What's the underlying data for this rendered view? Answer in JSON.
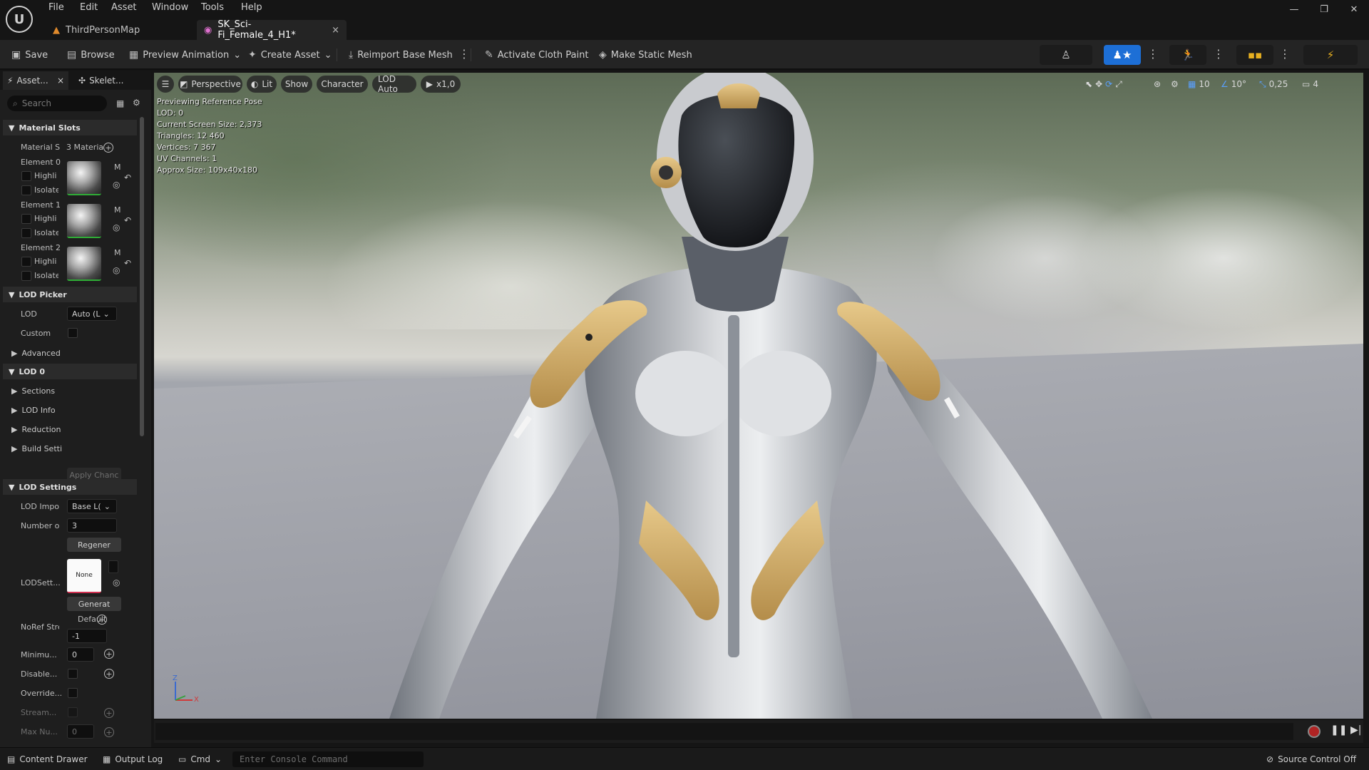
{
  "menu": [
    "File",
    "Edit",
    "Asset",
    "Window",
    "Tools",
    "Help"
  ],
  "tabs": [
    {
      "label": "ThirdPersonMap",
      "active": false
    },
    {
      "label": "SK_Sci-Fi_Female_4_H1*",
      "active": true
    }
  ],
  "toolbar": {
    "save": "Save",
    "browse": "Browse",
    "preview_animation": "Preview Animation",
    "create_asset": "Create Asset",
    "reimport": "Reimport Base Mesh",
    "cloth_paint": "Activate Cloth Paint",
    "static_mesh": "Make Static Mesh"
  },
  "panel_tabs": [
    "Asset...",
    "Skelet..."
  ],
  "search": {
    "placeholder": "Search"
  },
  "sections": {
    "material_slots": "Material Slots",
    "lod_picker": "LOD Picker",
    "advanced": "Advanced",
    "lod0": "LOD 0",
    "sections": "Sections",
    "lod_info": "LOD Info",
    "reduction": "Reduction",
    "build_settings": "Build Setti",
    "lod_settings": "LOD Settings"
  },
  "material": {
    "label": "Material S",
    "value": "3 Materia",
    "elements": [
      {
        "label": "Element 0",
        "highlight": "Highli",
        "isolate": "Isolate",
        "m": "M"
      },
      {
        "label": "Element 1",
        "highlight": "Highli",
        "isolate": "Isolate",
        "m": "M"
      },
      {
        "label": "Element 2",
        "highlight": "Highli",
        "isolate": "Isolate",
        "m": "M"
      }
    ]
  },
  "lod": {
    "lod_label": "LOD",
    "lod_value": "Auto (L",
    "custom_label": "Custom",
    "apply_changes": "Apply Chanc",
    "lod_import_label": "LOD Impoı",
    "lod_import_value": "Base L(",
    "number_label": "Number ol",
    "number_value": "3",
    "regen": "Regener",
    "lodsettings_label": "LODSett...",
    "none_label": "None",
    "generate": "Generat",
    "noref_label": "NoRef Stre",
    "noref_default": "Default",
    "noref_value": "-1",
    "minimum_label": "Minimu...",
    "minimum_value": "0",
    "disable_label": "Disable...",
    "override_label": "Override...",
    "stream_label": "Stream...",
    "maxnu_label": "Max Nu...",
    "maxnu_value": "0"
  },
  "viewport": {
    "perspective": "Perspective",
    "lit": "Lit",
    "show": "Show",
    "character": "Character",
    "lod_auto": "LOD Auto",
    "speed": "x1,0",
    "grid": "10",
    "angle": "10°",
    "scale": "0,25",
    "camera": "4",
    "stats": [
      "Previewing Reference Pose",
      "LOD: 0",
      "Current Screen Size: 2,373",
      "Triangles: 12 460",
      "Vertices: 7 367",
      "UV Channels: 1",
      "Approx Size: 109x40x180"
    ],
    "axis_z": "Z",
    "axis_x": "X"
  },
  "bottom": {
    "content_drawer": "Content Drawer",
    "output_log": "Output Log",
    "cmd": "Cmd",
    "console_placeholder": "Enter Console Command",
    "source_control": "Source Control Off"
  }
}
